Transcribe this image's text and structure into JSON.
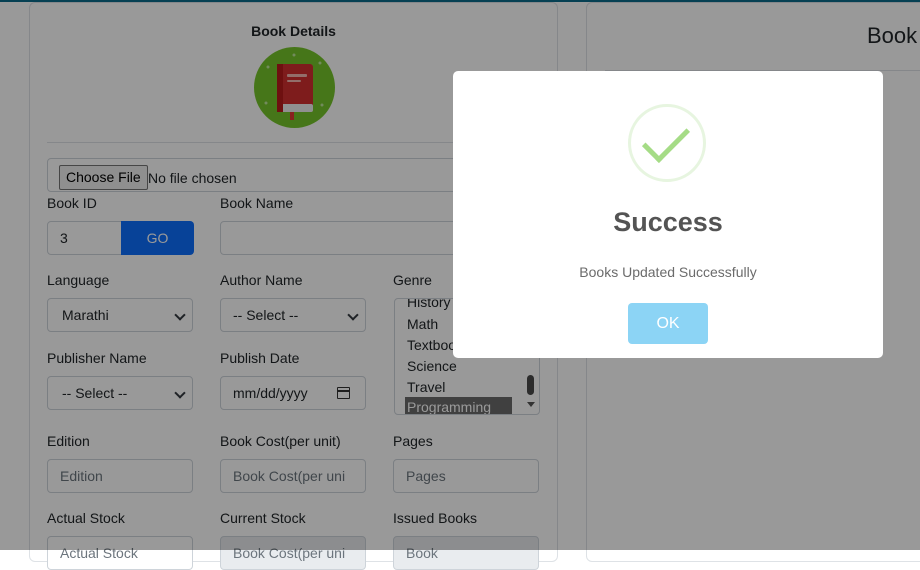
{
  "left_card": {
    "title": "Book Details",
    "file_button": "Choose File",
    "file_status": "No file chosen",
    "book_id": {
      "label": "Book ID",
      "value": "3",
      "go_button": "GO"
    },
    "book_name": {
      "label": "Book Name",
      "value": ""
    },
    "language": {
      "label": "Language",
      "value": "Marathi"
    },
    "author_name": {
      "label": "Author Name",
      "value": "-- Select --"
    },
    "genre": {
      "label": "Genre",
      "options": [
        "History",
        "Math",
        "Textbook",
        "Science",
        "Travel",
        "Programming"
      ],
      "selected": "Programming"
    },
    "publisher_name": {
      "label": "Publisher Name",
      "value": "-- Select --"
    },
    "publish_date": {
      "label": "Publish Date",
      "value": "mm/dd/yyyy"
    },
    "edition": {
      "label": "Edition",
      "placeholder": "Edition"
    },
    "book_cost": {
      "label": "Book Cost(per unit)",
      "placeholder": "Book Cost(per uni"
    },
    "pages": {
      "label": "Pages",
      "placeholder": "Pages"
    },
    "actual_stock": {
      "label": "Actual Stock",
      "placeholder": "Actual Stock"
    },
    "current_stock": {
      "label": "Current Stock",
      "placeholder": "Book Cost(per uni"
    },
    "issued_books": {
      "label": "Issued Books",
      "placeholder": "Book"
    }
  },
  "right_card": {
    "title": "Book"
  },
  "modal": {
    "title": "Success",
    "message": "Books Updated Successfully",
    "ok_button": "OK",
    "icon": "checkmark-icon"
  },
  "colors": {
    "primary": "#0d6efd",
    "success_check": "#a5dc86",
    "ok_button": "#8cd4f5",
    "header_line": "#0b6b8a"
  }
}
